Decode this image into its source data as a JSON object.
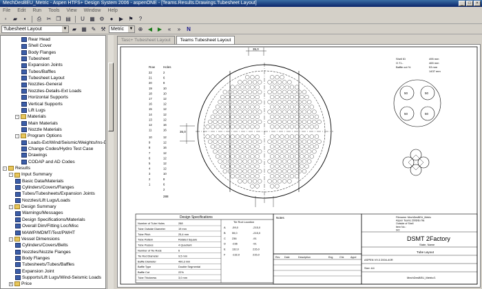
{
  "window": {
    "title": "MechDesBEU_Metric - Aspen HTFS+ Design System 2006 - aspenONE - [Teams.Results.Drawings.Tubesheet Layout]"
  },
  "menu": [
    "File",
    "Edit",
    "Run",
    "Tools",
    "View",
    "Window",
    "Help"
  ],
  "toolbar": {
    "nav_select": "Tubesheet Layout",
    "units_select": "Metric"
  },
  "tree": [
    {
      "label": "Rear Head",
      "depth": 3,
      "icon": "form-icon"
    },
    {
      "label": "Shell Cover",
      "depth": 3,
      "icon": "form-icon"
    },
    {
      "label": "Body Flanges",
      "depth": 3,
      "icon": "form-icon"
    },
    {
      "label": "Tubesheet",
      "depth": 3,
      "icon": "form-icon"
    },
    {
      "label": "Expansion Joints",
      "depth": 3,
      "icon": "form-icon"
    },
    {
      "label": "Tubes/Baffles",
      "depth": 3,
      "icon": "form-icon"
    },
    {
      "label": "Tubesheet Layout",
      "depth": 3,
      "icon": "form-icon"
    },
    {
      "label": "Nozzles-General",
      "depth": 3,
      "icon": "form-icon"
    },
    {
      "label": "Nozzles-Details-Ext Loads",
      "depth": 3,
      "icon": "form-icon"
    },
    {
      "label": "Horizontal Supports",
      "depth": 3,
      "icon": "form-icon"
    },
    {
      "label": "Vertical Supports",
      "depth": 3,
      "icon": "form-icon"
    },
    {
      "label": "Lift Lugs",
      "depth": 3,
      "icon": "form-icon"
    },
    {
      "label": "Materials",
      "depth": 2,
      "icon": "folder-icon",
      "expander": "-"
    },
    {
      "label": "Main Materials",
      "depth": 3,
      "icon": "form-icon"
    },
    {
      "label": "Nozzle Materials",
      "depth": 3,
      "icon": "form-icon"
    },
    {
      "label": "Program Options",
      "depth": 2,
      "icon": "folder-icon",
      "expander": "-"
    },
    {
      "label": "Loads-Ext/Wind/Seismic/Weights/Ins-Der",
      "depth": 3,
      "icon": "form-icon"
    },
    {
      "label": "Change Codes/Hydro Test Case",
      "depth": 3,
      "icon": "form-icon"
    },
    {
      "label": "Drawings",
      "depth": 3,
      "icon": "form-icon"
    },
    {
      "label": "CODAP and AD Codes",
      "depth": 3,
      "icon": "form-icon"
    },
    {
      "label": "Results",
      "depth": 0,
      "icon": "folder-icon",
      "expander": "-"
    },
    {
      "label": "Input Summary",
      "depth": 1,
      "icon": "folder-icon",
      "expander": "-"
    },
    {
      "label": "Basic Data/Materials",
      "depth": 2,
      "icon": "form-icon"
    },
    {
      "label": "Cylinders/Covers/Flanges",
      "depth": 2,
      "icon": "form-icon"
    },
    {
      "label": "Tubes/Tubesheets/Expansion Joints",
      "depth": 2,
      "icon": "form-icon"
    },
    {
      "label": "Nozzles/Lift Lugs/Loads",
      "depth": 2,
      "icon": "form-icon"
    },
    {
      "label": "Design Summary",
      "depth": 1,
      "icon": "folder-icon",
      "expander": "-"
    },
    {
      "label": "Warnings/Messages",
      "depth": 2,
      "icon": "form-icon"
    },
    {
      "label": "Design Specifications/Materials",
      "depth": 2,
      "icon": "form-icon"
    },
    {
      "label": "Overall Dim/Fitting Loc/Misc",
      "depth": 2,
      "icon": "form-icon"
    },
    {
      "label": "MAWP/MDMT/Test/PWHT",
      "depth": 2,
      "icon": "form-icon"
    },
    {
      "label": "Vessel Dimensions",
      "depth": 1,
      "icon": "folder-icon",
      "expander": "-"
    },
    {
      "label": "Cylinders/Covers/Belts",
      "depth": 2,
      "icon": "form-icon"
    },
    {
      "label": "Nozzles/Nozzle Flanges",
      "depth": 2,
      "icon": "form-icon"
    },
    {
      "label": "Body Flanges",
      "depth": 2,
      "icon": "form-icon"
    },
    {
      "label": "Tubesheets/Tubes/Baffles",
      "depth": 2,
      "icon": "form-icon"
    },
    {
      "label": "Expansion Joint",
      "depth": 2,
      "icon": "form-icon"
    },
    {
      "label": "Supports/Lift Lugs/Wind-Seismic Loads",
      "depth": 2,
      "icon": "form-icon"
    },
    {
      "label": "Price",
      "depth": 1,
      "icon": "folder-icon",
      "expander": "+"
    }
  ],
  "tabs": [
    {
      "label": "Tasc+ Tubesheet Layout",
      "active": false
    },
    {
      "label": "Teams Tubesheet Layout",
      "active": true
    }
  ],
  "drawing": {
    "top_dim": "35,0",
    "left_dim": "35,0",
    "row_header": "Row",
    "holes_header": "Holes",
    "rows_top": [
      {
        "row": "22",
        "holes": "2"
      },
      {
        "row": "21",
        "holes": "6"
      },
      {
        "row": "20",
        "holes": "8"
      },
      {
        "row": "19",
        "holes": "10"
      },
      {
        "row": "18",
        "holes": "10"
      },
      {
        "row": "17",
        "holes": "12"
      },
      {
        "row": "16",
        "holes": "12"
      },
      {
        "row": "15",
        "holes": "12"
      },
      {
        "row": "14",
        "holes": "12"
      },
      {
        "row": "13",
        "holes": "12"
      },
      {
        "row": "12",
        "holes": "16"
      },
      {
        "row": "11",
        "holes": "16"
      }
    ],
    "rows_bottom": [
      {
        "row": "10",
        "holes": "12"
      },
      {
        "row": "9",
        "holes": "12"
      },
      {
        "row": "8",
        "holes": "16"
      },
      {
        "row": "7",
        "holes": "12"
      },
      {
        "row": "6",
        "holes": "12"
      },
      {
        "row": "5",
        "holes": "12"
      },
      {
        "row": "4",
        "holes": "12"
      },
      {
        "row": "3",
        "holes": "10"
      },
      {
        "row": "2",
        "holes": "8"
      },
      {
        "row": "1",
        "holes": "6"
      },
      {
        "row": "",
        "holes": "2"
      }
    ],
    "total_holes": "288",
    "info_labels": [
      "Shell ID",
      "O.T.L.",
      "Baffle cut %"
    ],
    "info_values": [
      "495 mm",
      "465 mm",
      "53 mm",
      "1437 mm"
    ],
    "pitch_labels": [
      "50",
      "50",
      "50",
      "50"
    ],
    "specs": {
      "title": "Design Specifications",
      "rows": [
        {
          "label": "Number of Tube Holes",
          "value": "288"
        },
        {
          "label": "Tube Outside Diameter",
          "value": "19 mm"
        },
        {
          "label": "Tube Pitch",
          "value": "25,4 mm"
        },
        {
          "label": "Tube Pattern",
          "value": "Rotated Square"
        },
        {
          "label": "Tube Passes",
          "value": "4  Quadrant"
        },
        {
          "label": "Number of Tie Rods",
          "value": "6"
        },
        {
          "label": "Tie Rod Diameter",
          "value": "9,5 mm"
        },
        {
          "label": "Baffle Diameter",
          "value": "490,3 mm"
        },
        {
          "label": "Baffle Type",
          "value": "Double Segmental"
        },
        {
          "label": "Baffle Cut",
          "value": "22%"
        },
        {
          "label": "Tube Thickness",
          "value": "3,0 mm"
        }
      ],
      "tierod_title": "Tie Rod Location",
      "tierods": [
        {
          "id": "A",
          "x": "-59,0",
          "y": "-215,0"
        },
        {
          "id": "B",
          "x": "59,0",
          "y": "-215,0"
        },
        {
          "id": "C",
          "x": "236",
          "y": "-91"
        },
        {
          "id": "D",
          "x": "-236",
          "y": "-91"
        },
        {
          "id": "E",
          "x": "132,0",
          "y": "215,0"
        },
        {
          "id": "F",
          "x": "-132,0",
          "y": "215,0"
        }
      ]
    },
    "notes_label": "Notes",
    "filename_block": [
      "Filename: MechDesBEU_Metric",
      "Aspen Teams 2006/Ex file",
      "Outside of Shell",
      "Item No.:",
      "SO:"
    ],
    "company": "DSMT 2Factory",
    "location": "State, Name",
    "drawing_title": "Tube Layout",
    "revision_headers": [
      "Rev",
      "Date",
      "Description",
      "Eng",
      "Chk",
      "Appd"
    ],
    "title_block": {
      "software": "ASPEN V9.3 2004-40R",
      "drawing_no": "Size: A4",
      "sheet": "MechDesBEU_Metric/1"
    }
  }
}
